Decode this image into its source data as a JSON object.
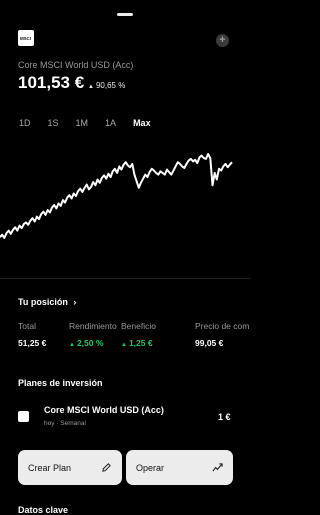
{
  "header": {
    "logo_text": "MSCI",
    "add_icon": "plus-icon"
  },
  "fund": {
    "name": "Core MSCI World USD (Acc)",
    "price": "101,53 €",
    "change": "90,65 %"
  },
  "ranges": [
    "1D",
    "1S",
    "1M",
    "1A",
    "Max"
  ],
  "active_range": "Max",
  "chart_data": {
    "type": "line",
    "series": [
      {
        "values": [
          100,
          103,
          99,
          105,
          108,
          104,
          109,
          112,
          108,
          114,
          111,
          116,
          118,
          115,
          120,
          123,
          119,
          125,
          122,
          128,
          131,
          127,
          133,
          130,
          136,
          139,
          135,
          141,
          138,
          145,
          142,
          148,
          151,
          147,
          153,
          150,
          156,
          159,
          155,
          160,
          164,
          158,
          161,
          167,
          163,
          170,
          166,
          172,
          175,
          171,
          177,
          173,
          180,
          183,
          178,
          186,
          182,
          188,
          191,
          187,
          185,
          189,
          176,
          168,
          160,
          166,
          171,
          176,
          173,
          179,
          183,
          181,
          178,
          176,
          180,
          178,
          176,
          182,
          179,
          176,
          181,
          186,
          191,
          189,
          186,
          184,
          189,
          193,
          195,
          192,
          194,
          190,
          197,
          199,
          196,
          195,
          201,
          196,
          163,
          178,
          170,
          183,
          181,
          186,
          189,
          185,
          188,
          191
        ]
      }
    ],
    "grid": false
  },
  "position": {
    "title": "Tu posición",
    "chevron": "›"
  },
  "metrics": [
    {
      "label": "Total",
      "value": "51,25 €",
      "color": "#ffffff"
    },
    {
      "label": "Rendimiento",
      "value": "2,50 %",
      "color": "#27c46b",
      "up": true
    },
    {
      "label": "Beneficio",
      "value": "1,25 €",
      "color": "#27c46b",
      "up": true
    },
    {
      "label": "Precio de com",
      "value": "99,05 €",
      "color": "#ffffff"
    }
  ],
  "plans": {
    "title": "Planes de inversión",
    "item": {
      "name": "Core MSCI World USD (Acc)",
      "subtitle": "hoy · Semanal",
      "amount": "1 €"
    }
  },
  "buttons": {
    "create_label": "Crear Plan",
    "operate_label": "Operar"
  },
  "key_data_title": "Datos clave"
}
